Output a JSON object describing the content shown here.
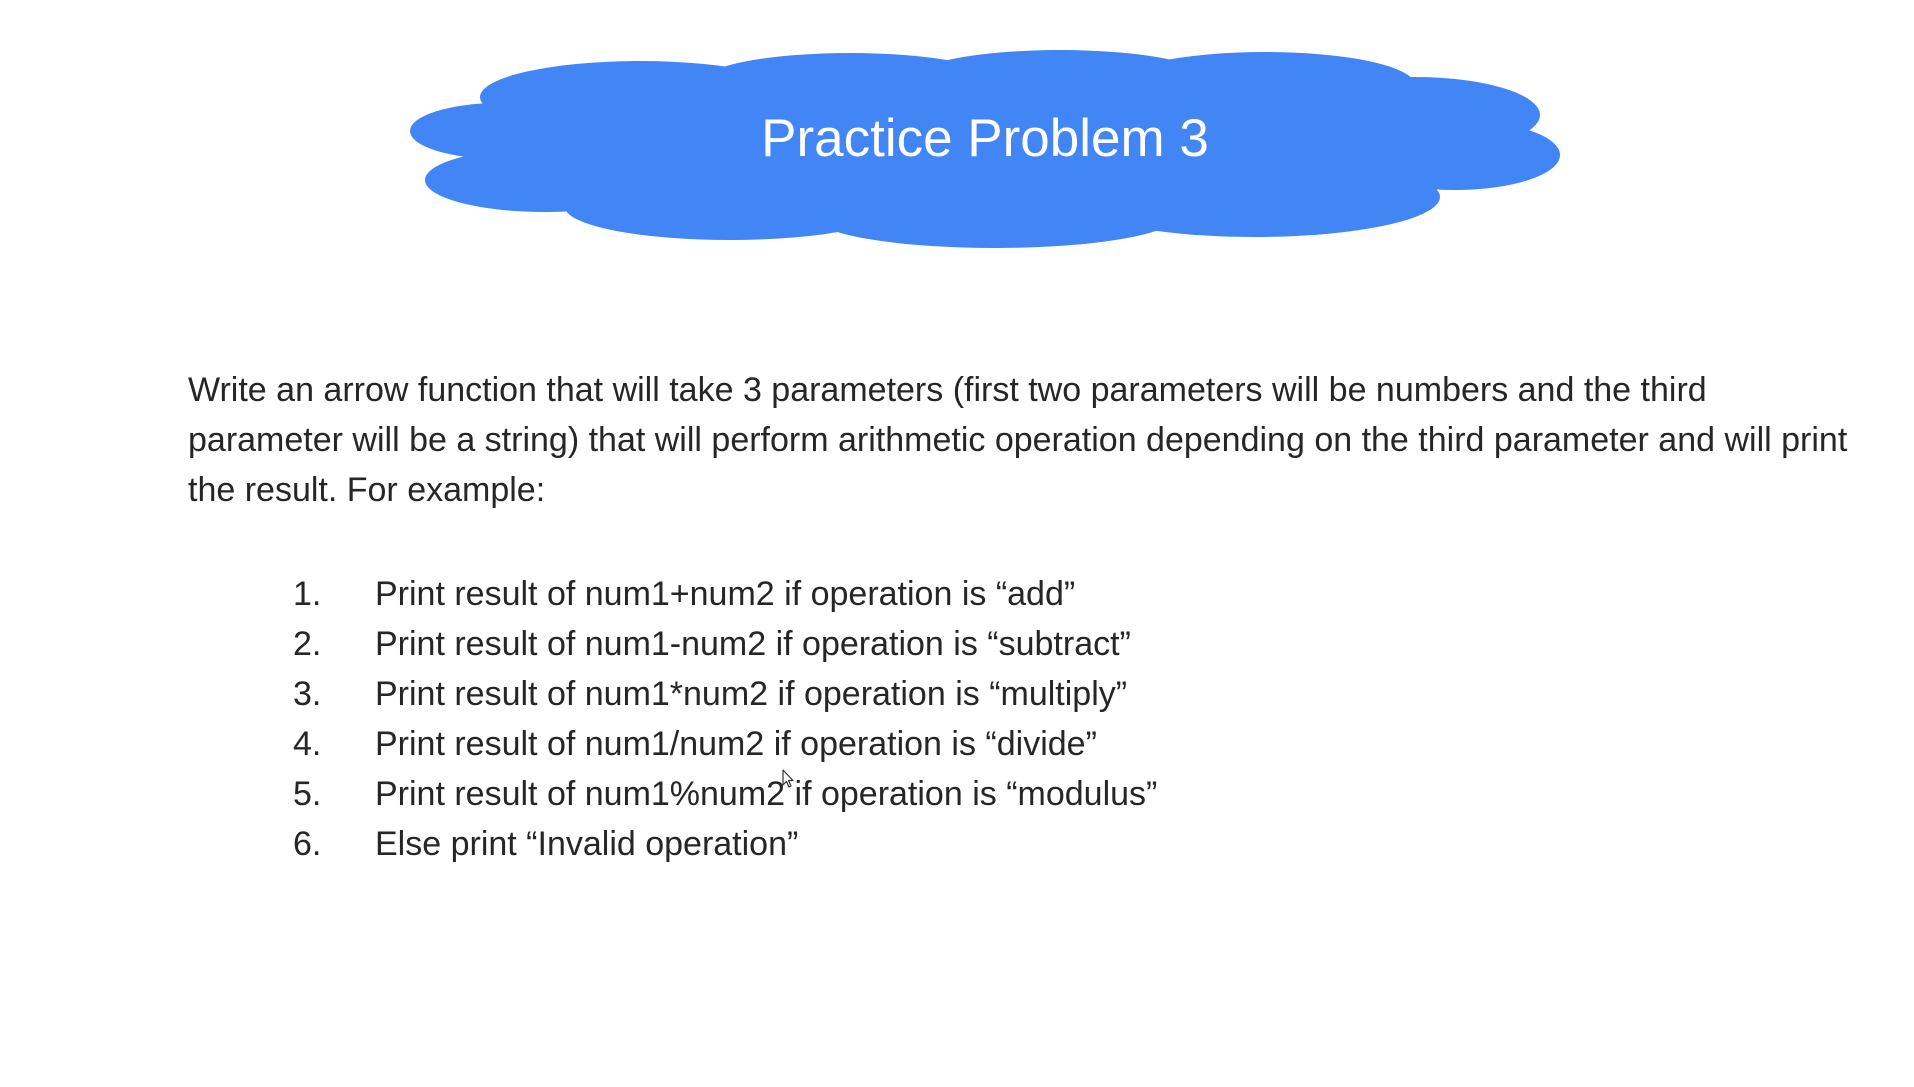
{
  "slide": {
    "title": "Practice Problem 3",
    "cloud_color": "#4285f4",
    "description": "Write an arrow function that will take 3 parameters (first two parameters will be numbers and the third parameter will be a string) that will perform arithmetic operation depending on the third parameter and will print the result. For example:",
    "rules": [
      {
        "number": "1.",
        "text": "Print result of num1+num2 if operation is “add”"
      },
      {
        "number": "2.",
        "text": "Print result of num1-num2 if operation is “subtract”"
      },
      {
        "number": "3.",
        "text": "Print result of num1*num2 if operation is “multiply”"
      },
      {
        "number": "4.",
        "text": "Print result of num1/num2 if operation is “divide”"
      },
      {
        "number": "5.",
        "text": "Print result of num1%num2 if operation is “modulus”"
      },
      {
        "number": "6.",
        "text": "Else print “Invalid operation”"
      }
    ],
    "cursor_icon": "mouse-pointer-icon"
  }
}
